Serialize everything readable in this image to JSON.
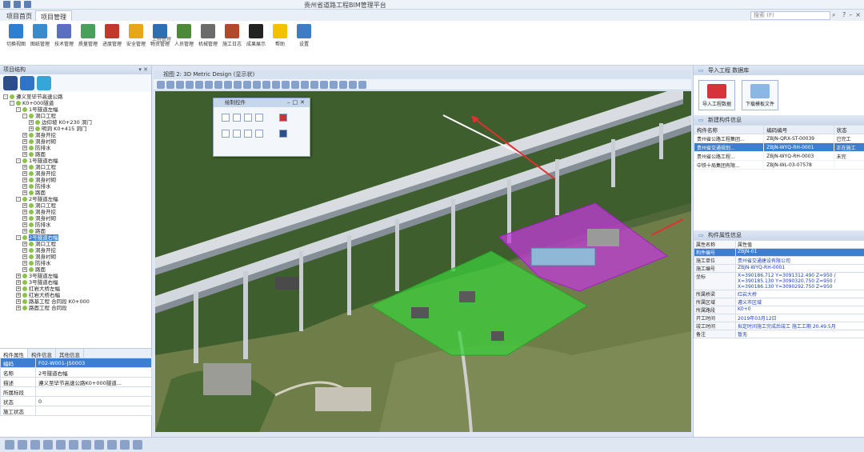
{
  "window": {
    "title": "贵州省道路工程BIM管理平台"
  },
  "ribbon": {
    "tabs": [
      "项目首页",
      "项目管理"
    ],
    "active_tab": "项目管理",
    "search_placeholder": "搜索 (F)",
    "buttons": [
      {
        "label": "切换视图",
        "icon": "switch-view-icon",
        "color": "#2f7fd0"
      },
      {
        "label": "图纸管理",
        "icon": "drawings-icon",
        "color": "#3b8ac9"
      },
      {
        "label": "技术管理",
        "icon": "tech-icon",
        "color": "#5a6fc0"
      },
      {
        "label": "质量管理",
        "icon": "quality-icon",
        "color": "#4aa05a"
      },
      {
        "label": "进度管理",
        "icon": "schedule-icon",
        "color": "#c0392b"
      },
      {
        "label": "安全管理",
        "icon": "safety-icon",
        "color": "#e6a817"
      },
      {
        "label": "物资管理",
        "icon": "materials-icon",
        "color": "#2c6fb3"
      },
      {
        "label": "人员管理",
        "icon": "personnel-icon",
        "color": "#4c8a3a"
      },
      {
        "label": "机械管理",
        "icon": "machinery-icon",
        "color": "#6b6b6b"
      },
      {
        "label": "施工日志",
        "icon": "log-icon",
        "color": "#b04a2a"
      },
      {
        "label": "成果展示",
        "icon": "results-icon",
        "color": "#222222"
      },
      {
        "label": "帮助",
        "icon": "bulb-icon",
        "color": "#f2c200"
      },
      {
        "label": "设置",
        "icon": "settings-icon",
        "color": "#3f7cc6"
      }
    ],
    "group_label": "工程管理"
  },
  "left_panel": {
    "title": "项目结构",
    "tree": [
      {
        "level": 0,
        "label": "遵义至毕节高速公路",
        "exp": "-"
      },
      {
        "level": 1,
        "label": "K0+000隧道",
        "exp": "-"
      },
      {
        "level": 2,
        "label": "1号隧道左幅",
        "exp": "-"
      },
      {
        "level": 3,
        "label": "洞口工程",
        "exp": "-"
      },
      {
        "level": 4,
        "label": "边仰坡 K0+230 洞门",
        "exp": "+"
      },
      {
        "level": 4,
        "label": "明洞 K0+415 洞门",
        "exp": "+"
      },
      {
        "level": 3,
        "label": "洞身开挖",
        "exp": "+"
      },
      {
        "level": 3,
        "label": "洞身衬砌",
        "exp": "+"
      },
      {
        "level": 3,
        "label": "防排水",
        "exp": "+"
      },
      {
        "level": 3,
        "label": "路面",
        "exp": "+"
      },
      {
        "level": 2,
        "label": "1号隧道右幅",
        "exp": "-"
      },
      {
        "level": 3,
        "label": "洞口工程",
        "exp": "+"
      },
      {
        "level": 3,
        "label": "洞身开挖",
        "exp": "+"
      },
      {
        "level": 3,
        "label": "洞身衬砌",
        "exp": "+"
      },
      {
        "level": 3,
        "label": "防排水",
        "exp": "+"
      },
      {
        "level": 3,
        "label": "路面",
        "exp": "+"
      },
      {
        "level": 2,
        "label": "2号隧道左幅",
        "exp": "-"
      },
      {
        "level": 3,
        "label": "洞口工程",
        "exp": "+"
      },
      {
        "level": 3,
        "label": "洞身开挖",
        "exp": "+"
      },
      {
        "level": 3,
        "label": "洞身衬砌",
        "exp": "+"
      },
      {
        "level": 3,
        "label": "防排水",
        "exp": "+"
      },
      {
        "level": 3,
        "label": "路面",
        "exp": "+"
      },
      {
        "level": 2,
        "label": "2号隧道右幅",
        "exp": "-",
        "selected": true
      },
      {
        "level": 3,
        "label": "洞口工程",
        "exp": "+"
      },
      {
        "level": 3,
        "label": "洞身开挖",
        "exp": "+"
      },
      {
        "level": 3,
        "label": "洞身衬砌",
        "exp": "+"
      },
      {
        "level": 3,
        "label": "防排水",
        "exp": "+"
      },
      {
        "level": 3,
        "label": "路面",
        "exp": "+"
      },
      {
        "level": 2,
        "label": "3号隧道左幅",
        "exp": "+"
      },
      {
        "level": 2,
        "label": "3号隧道右幅",
        "exp": "+"
      },
      {
        "level": 2,
        "label": "红岩大桥左幅",
        "exp": "+"
      },
      {
        "level": 2,
        "label": "红岩大桥右幅",
        "exp": "+"
      },
      {
        "level": 2,
        "label": "路基工程 合同段 K0+000",
        "exp": "+"
      },
      {
        "level": 2,
        "label": "路面工程 合同段",
        "exp": "+"
      }
    ],
    "prop_tabs": [
      "构件属性",
      "构件信息",
      "其他信息"
    ],
    "props": [
      [
        "编码",
        "F02-W001-JS0003"
      ],
      [
        "名称",
        "2号隧道右幅"
      ],
      [
        "描述",
        "遵义至毕节高速公路K0+000隧道..."
      ],
      [
        "所属标段",
        ""
      ],
      [
        "状态",
        "0"
      ],
      [
        "施工状态",
        ""
      ]
    ]
  },
  "view": {
    "tab_title": "视图 2: 3D Metric Design (显示状)",
    "palette_title": "绘制控件"
  },
  "right_panel": {
    "section1_title": "导入工程 数据库",
    "import_buttons": [
      "导入工程数据",
      "下载模板文件"
    ],
    "section2_title": "新建构件信息",
    "list_headers": [
      "构件名称",
      "编码编号",
      "状态"
    ],
    "list_rows": [
      [
        "贵州省公路工程集团...",
        "ZBJN-QRX-ST-00039",
        "已完工"
      ],
      [
        "贵州省交通规划...",
        "ZBJN-WYQ-RH-0001",
        "正在施工"
      ],
      [
        "贵州省公路工程...",
        "ZBJN-WYQ-RH-0003",
        "未完"
      ],
      [
        "中铁十局集团有限...",
        "ZBJN-WL-03-07578",
        ""
      ]
    ],
    "selected_list_row": 1,
    "section3_title": "构件属性信息",
    "attr_header": [
      "属性名称",
      "属性值"
    ],
    "attrs": [
      [
        "构件编号",
        "ZBJN-01"
      ],
      [
        "施工单位",
        "贵州省交通建设有限公司"
      ],
      [
        "施工编号",
        "ZBJN-WYQ-RH-0001"
      ],
      [
        "坐标",
        "X=390186.712 Y=3091312.490 Z=950 / X=390185.130 Y=3090320.750 Z=950 / X=390186.130 Y=3090292.750 Z=950"
      ],
      [
        "所属桥梁",
        "红岩大桥"
      ],
      [
        "所属区域",
        "遵义市区域"
      ],
      [
        "所属路段",
        "K0+0"
      ],
      [
        "开工时间",
        "2019年03月12日"
      ],
      [
        "竣工时间",
        "拟定时间施工完成后竣工 施工工期 20.49.5月"
      ],
      [
        "备注",
        "暂无"
      ]
    ]
  }
}
